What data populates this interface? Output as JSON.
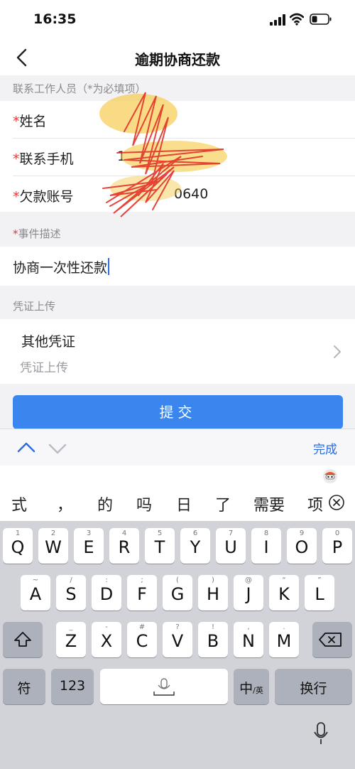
{
  "status_bar": {
    "time": "16:35"
  },
  "nav": {
    "title": "逾期协商还款"
  },
  "contact_section": {
    "label_prefix": "联系工作人员（",
    "label_req": "*",
    "label_suffix": "为必填项）",
    "rows": [
      {
        "label": "姓名",
        "value": ""
      },
      {
        "label": "联系手机",
        "value": "1"
      },
      {
        "label": "欠款账号",
        "value": "0640"
      }
    ]
  },
  "event_section": {
    "label": "事件描述",
    "value": "协商一次性还款"
  },
  "evidence_section": {
    "label": "凭证上传",
    "title": "其他凭证",
    "subtitle": "凭证上传"
  },
  "submit_label": "提交",
  "toolbar": {
    "done_label": "完成"
  },
  "ime": {
    "candidates": [
      "式",
      "，",
      "的",
      "吗",
      "日",
      "了",
      "需要",
      "项"
    ]
  },
  "keyboard": {
    "row1": [
      {
        "main": "Q",
        "sub": "1"
      },
      {
        "main": "W",
        "sub": "2"
      },
      {
        "main": "E",
        "sub": "3"
      },
      {
        "main": "R",
        "sub": "4"
      },
      {
        "main": "T",
        "sub": "5"
      },
      {
        "main": "Y",
        "sub": "6"
      },
      {
        "main": "U",
        "sub": "7"
      },
      {
        "main": "I",
        "sub": "8"
      },
      {
        "main": "O",
        "sub": "9"
      },
      {
        "main": "P",
        "sub": "0"
      }
    ],
    "row2": [
      {
        "main": "A",
        "sub": "~"
      },
      {
        "main": "S",
        "sub": "/"
      },
      {
        "main": "D",
        "sub": ":"
      },
      {
        "main": "F",
        "sub": ";"
      },
      {
        "main": "G",
        "sub": "("
      },
      {
        "main": "H",
        "sub": ")"
      },
      {
        "main": "J",
        "sub": "@"
      },
      {
        "main": "K",
        "sub": "“"
      },
      {
        "main": "L",
        "sub": "”"
      }
    ],
    "row3": [
      {
        "main": "Z",
        "sub": "_"
      },
      {
        "main": "X",
        "sub": "-"
      },
      {
        "main": "C",
        "sub": "#"
      },
      {
        "main": "V",
        "sub": "?"
      },
      {
        "main": "B",
        "sub": "!"
      },
      {
        "main": "N",
        "sub": ","
      },
      {
        "main": "M",
        "sub": "."
      }
    ],
    "symbols_label": "符",
    "numbers_label": "123",
    "lang_main": "中",
    "lang_sub": "/英",
    "return_label": "换行"
  }
}
